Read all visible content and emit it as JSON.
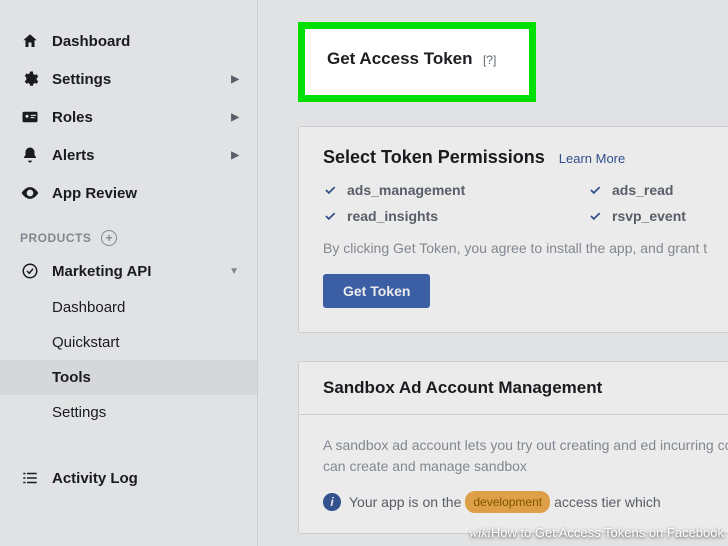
{
  "sidebar": {
    "items": [
      {
        "label": "Dashboard"
      },
      {
        "label": "Settings"
      },
      {
        "label": "Roles"
      },
      {
        "label": "Alerts"
      },
      {
        "label": "App Review"
      }
    ],
    "products_label": "PRODUCTS",
    "product": {
      "label": "Marketing API"
    },
    "subitems": [
      {
        "label": "Dashboard"
      },
      {
        "label": "Quickstart"
      },
      {
        "label": "Tools"
      },
      {
        "label": "Settings"
      }
    ],
    "activity": "Activity Log"
  },
  "highlight": {
    "title": "Get Access Token",
    "help": "[?]"
  },
  "permissions": {
    "title": "Select Token Permissions",
    "learn_more": "Learn More",
    "items": [
      {
        "label": "ads_management"
      },
      {
        "label": "ads_read"
      },
      {
        "label": "read_insights"
      },
      {
        "label": "rsvp_event"
      }
    ],
    "agree_text": "By clicking Get Token, you agree to install the app, and grant t",
    "button": "Get Token"
  },
  "sandbox": {
    "title": "Sandbox Ad Account Management",
    "body": "A sandbox ad account lets you try out creating and ed incurring costs. You can create and manage sandbox",
    "info_prefix": "Your app is",
    "badge_left": "on the",
    "badge": "development",
    "badge_right": "access tier which"
  },
  "caption": "How to Get Access Tokens on Facebook",
  "caption_prefix": "wiki"
}
